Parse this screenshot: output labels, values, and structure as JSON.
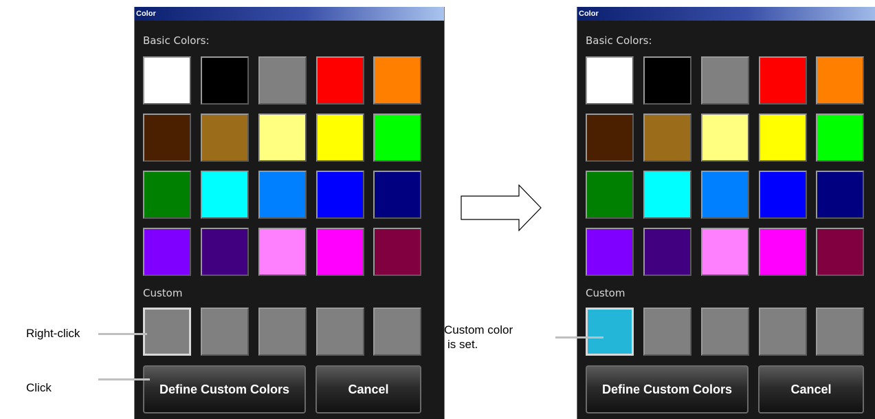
{
  "left_dialog": {
    "title": "Color",
    "basic_colors_label": "Basic Colors:",
    "custom_label": "Custom",
    "define_button": "Define Custom Colors",
    "cancel_button": "Cancel",
    "custom_colors": [
      "#808080",
      "#808080",
      "#808080",
      "#808080",
      "#808080"
    ],
    "selected_custom_index": 0
  },
  "right_dialog": {
    "title": "Color",
    "basic_colors_label": "Basic Colors:",
    "custom_label": "Custom",
    "define_button": "Define Custom Colors",
    "cancel_button": "Cancel",
    "custom_colors": [
      "#23b6d8",
      "#808080",
      "#808080",
      "#808080",
      "#808080"
    ],
    "selected_custom_index": 0
  },
  "basic_colors": [
    [
      "#ffffff",
      "#000000",
      "#808080",
      "#ff0000",
      "#ff8000"
    ],
    [
      "#4a2000",
      "#9b6c1a",
      "#ffff80",
      "#ffff00",
      "#00ff00"
    ],
    [
      "#008000",
      "#00ffff",
      "#0080ff",
      "#0000ff",
      "#000080"
    ],
    [
      "#8000ff",
      "#400080",
      "#ff80ff",
      "#ff00ff",
      "#800040"
    ]
  ],
  "annotations": {
    "right_click": "Right-click",
    "click": "Click",
    "custom_set_line1": "Custom color",
    "custom_set_line2": "is set."
  }
}
